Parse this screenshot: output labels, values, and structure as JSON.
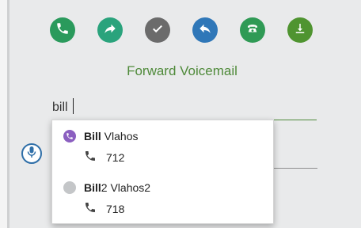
{
  "actions": [
    {
      "icon": "phone-icon",
      "color": "#2a9a5c"
    },
    {
      "icon": "forward-arrow-icon",
      "color": "#2aa37c"
    },
    {
      "icon": "checkmark-icon",
      "color": "#6b6b6b"
    },
    {
      "icon": "reply-arrow-icon",
      "color": "#2f77b8"
    },
    {
      "icon": "telephone-handset-icon",
      "color": "#2f9a55"
    },
    {
      "icon": "download-icon",
      "color": "#4f9430"
    }
  ],
  "title": "Forward Voicemail",
  "search": {
    "value": "bill"
  },
  "suggestions": [
    {
      "name_bold": "Bill",
      "name_rest": " Vlahos",
      "extension": "712",
      "status_color": "#8b5fc0",
      "status_icon": "viber-phone-icon"
    },
    {
      "name_bold": "Bill",
      "name_rest": "2 Vlahos2",
      "extension": "718",
      "status_color": "#c4c6c8",
      "status_icon": "status-dot-icon"
    }
  ],
  "colors": {
    "accent_green": "#4f8a3a",
    "mic_blue": "#2f6fa8"
  }
}
